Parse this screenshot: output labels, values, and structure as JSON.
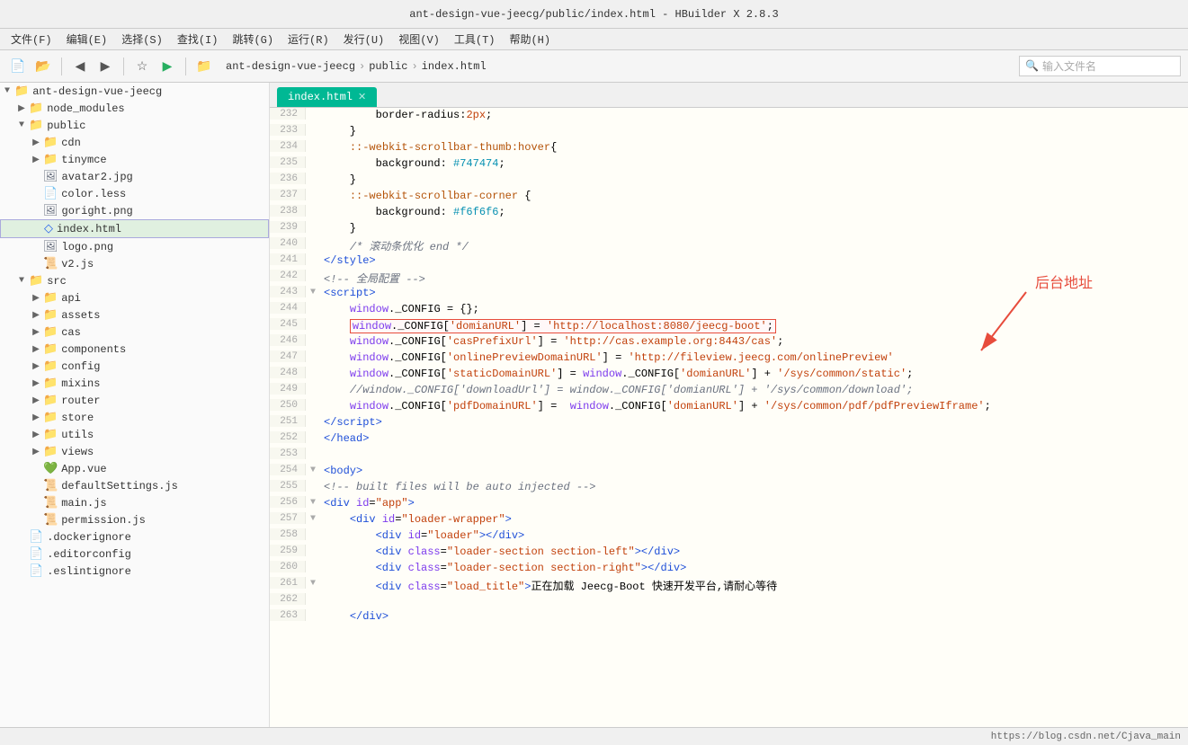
{
  "titlebar": {
    "title": "ant-design-vue-jeecg/public/index.html - HBuilder X 2.8.3"
  },
  "menubar": {
    "items": [
      "文件(F)",
      "编辑(E)",
      "选择(S)",
      "查找(I)",
      "跳转(G)",
      "运行(R)",
      "发行(U)",
      "视图(V)",
      "工具(T)",
      "帮助(H)"
    ]
  },
  "toolbar": {
    "breadcrumb": [
      "ant-design-vue-jeecg",
      "public",
      "index.html"
    ]
  },
  "search": {
    "placeholder": "输入文件名"
  },
  "tab": {
    "label": "index.html"
  },
  "sidebar": {
    "tree": [
      {
        "id": "root",
        "label": "ant-design-vue-jeecg",
        "indent": 0,
        "type": "folder",
        "expanded": true,
        "arrow": "▼"
      },
      {
        "id": "node_modules",
        "label": "node_modules",
        "indent": 1,
        "type": "folder",
        "expanded": false,
        "arrow": "▶"
      },
      {
        "id": "public",
        "label": "public",
        "indent": 1,
        "type": "folder",
        "expanded": true,
        "arrow": "▼"
      },
      {
        "id": "cdn",
        "label": "cdn",
        "indent": 2,
        "type": "folder",
        "expanded": false,
        "arrow": "▶"
      },
      {
        "id": "tinymce",
        "label": "tinymce",
        "indent": 2,
        "type": "folder",
        "expanded": false,
        "arrow": "▶"
      },
      {
        "id": "avatar2",
        "label": "avatar2.jpg",
        "indent": 2,
        "type": "image"
      },
      {
        "id": "color",
        "label": "color.less",
        "indent": 2,
        "type": "less"
      },
      {
        "id": "goright",
        "label": "goright.png",
        "indent": 2,
        "type": "image"
      },
      {
        "id": "index",
        "label": "index.html",
        "indent": 2,
        "type": "html",
        "selected": true
      },
      {
        "id": "logo",
        "label": "logo.png",
        "indent": 2,
        "type": "image"
      },
      {
        "id": "v2",
        "label": "v2.js",
        "indent": 2,
        "type": "js"
      },
      {
        "id": "src",
        "label": "src",
        "indent": 1,
        "type": "folder",
        "expanded": true,
        "arrow": "▼"
      },
      {
        "id": "api",
        "label": "api",
        "indent": 2,
        "type": "folder",
        "expanded": false,
        "arrow": "▶"
      },
      {
        "id": "assets",
        "label": "assets",
        "indent": 2,
        "type": "folder",
        "expanded": false,
        "arrow": "▶"
      },
      {
        "id": "cas",
        "label": "cas",
        "indent": 2,
        "type": "folder",
        "expanded": false,
        "arrow": "▶"
      },
      {
        "id": "components",
        "label": "components",
        "indent": 2,
        "type": "folder",
        "expanded": false,
        "arrow": "▶"
      },
      {
        "id": "config",
        "label": "config",
        "indent": 2,
        "type": "folder",
        "expanded": false,
        "arrow": "▶"
      },
      {
        "id": "mixins",
        "label": "mixins",
        "indent": 2,
        "type": "folder",
        "expanded": false,
        "arrow": "▶"
      },
      {
        "id": "router",
        "label": "router",
        "indent": 2,
        "type": "folder",
        "expanded": false,
        "arrow": "▶"
      },
      {
        "id": "store",
        "label": "store",
        "indent": 2,
        "type": "folder",
        "expanded": false,
        "arrow": "▶"
      },
      {
        "id": "utils",
        "label": "utils",
        "indent": 2,
        "type": "folder",
        "expanded": false,
        "arrow": "▶"
      },
      {
        "id": "views",
        "label": "views",
        "indent": 2,
        "type": "folder",
        "expanded": false,
        "arrow": "▶"
      },
      {
        "id": "appvue",
        "label": "App.vue",
        "indent": 2,
        "type": "vue"
      },
      {
        "id": "defaultSettings",
        "label": "defaultSettings.js",
        "indent": 2,
        "type": "js"
      },
      {
        "id": "mainjs",
        "label": "main.js",
        "indent": 2,
        "type": "js"
      },
      {
        "id": "permission",
        "label": "permission.js",
        "indent": 2,
        "type": "js"
      },
      {
        "id": "dockerignore",
        "label": ".dockerignore",
        "indent": 1,
        "type": "file"
      },
      {
        "id": "editorconfig",
        "label": ".editorconfig",
        "indent": 1,
        "type": "file"
      },
      {
        "id": "eslintignore",
        "label": ".eslintignore",
        "indent": 1,
        "type": "file"
      }
    ]
  },
  "annotation": {
    "label": "后台地址"
  },
  "code_lines": [
    {
      "num": 232,
      "fold": "",
      "content": "        border-radius:<span class='c-string'>2px</span>;"
    },
    {
      "num": 233,
      "fold": "",
      "content": "    }"
    },
    {
      "num": 234,
      "fold": "",
      "content": "    <span class='c-property'>::-webkit-scrollbar-thumb:hover</span>{"
    },
    {
      "num": 235,
      "fold": "",
      "content": "        background: <span class='c-hex'>#747474</span>;"
    },
    {
      "num": 236,
      "fold": "",
      "content": "    }"
    },
    {
      "num": 237,
      "fold": "",
      "content": "    <span class='c-property'>::-webkit-scrollbar-corner</span> {"
    },
    {
      "num": 238,
      "fold": "",
      "content": "        background: <span class='c-hex'>#f6f6f6</span>;"
    },
    {
      "num": 239,
      "fold": "",
      "content": "    }"
    },
    {
      "num": 240,
      "fold": "",
      "content": "    <span class='c-comment'>/* 滚动条优化 end */</span>"
    },
    {
      "num": 241,
      "fold": "",
      "content": "<span class='c-tag'>&lt;/style&gt;</span>"
    },
    {
      "num": 242,
      "fold": "",
      "content": "<span class='c-comment'>&lt;!-- 全局配置 --&gt;</span>"
    },
    {
      "num": 243,
      "fold": "▼",
      "content": "<span class='c-tag'>&lt;script&gt;</span>"
    },
    {
      "num": 244,
      "fold": "",
      "content": "    <span class='c-keyword'>window</span>._CONFIG = {};"
    },
    {
      "num": 245,
      "fold": "",
      "content": "    <span class='red-outline'><span class='c-keyword'>window</span>._CONFIG[<span class='c-string'>'domianURL'</span>] = <span class='c-string'>'http://localhost:8080/jeecg-boot'</span>;</span>"
    },
    {
      "num": 246,
      "fold": "",
      "content": "    <span class='c-keyword'>window</span>._CONFIG[<span class='c-string'>'casPrefixUrl'</span>] = <span class='c-string'>'http://cas.example.org:8443/cas'</span>;"
    },
    {
      "num": 247,
      "fold": "",
      "content": "    <span class='c-keyword'>window</span>._CONFIG[<span class='c-string'>'onlinePreviewDomainURL'</span>] = <span class='c-string'>'http://fileview.jeecg.com/onlinePreview'</span>"
    },
    {
      "num": 248,
      "fold": "",
      "content": "    <span class='c-keyword'>window</span>._CONFIG[<span class='c-string'>'staticDomainURL'</span>] = <span class='c-keyword'>window</span>._CONFIG[<span class='c-string'>'domianURL'</span>] + <span class='c-string'>'/sys/common/static'</span>;"
    },
    {
      "num": 249,
      "fold": "",
      "content": "    <span class='c-comment'>//window._CONFIG['downloadUrl'] = window._CONFIG['domianURL'] + '/sys/common/download';</span>"
    },
    {
      "num": 250,
      "fold": "",
      "content": "    <span class='c-keyword'>window</span>._CONFIG[<span class='c-string'>'pdfDomainURL'</span>] =  <span class='c-keyword'>window</span>._CONFIG[<span class='c-string'>'domianURL'</span>] + <span class='c-string'>'/sys/common/pdf/pdfPreviewIframe'</span>;"
    },
    {
      "num": 251,
      "fold": "",
      "content": "<span class='c-tag'>&lt;/script&gt;</span>"
    },
    {
      "num": 252,
      "fold": "",
      "content": "<span class='c-tag'>&lt;/head&gt;</span>"
    },
    {
      "num": 253,
      "fold": "",
      "content": ""
    },
    {
      "num": 254,
      "fold": "▼",
      "content": "<span class='c-tag'>&lt;body&gt;</span>"
    },
    {
      "num": 255,
      "fold": "",
      "content": "<span class='c-comment'>&lt;!-- built files will be auto injected --&gt;</span>"
    },
    {
      "num": 256,
      "fold": "▼",
      "content": "<span class='c-tag'>&lt;div</span> <span class='c-attr'>id</span>=<span class='c-value'>\"app\"</span><span class='c-tag'>&gt;</span>"
    },
    {
      "num": 257,
      "fold": "▼",
      "content": "    <span class='c-tag'>&lt;div</span> <span class='c-attr'>id</span>=<span class='c-value'>\"loader-wrapper\"</span><span class='c-tag'>&gt;</span>"
    },
    {
      "num": 258,
      "fold": "",
      "content": "        <span class='c-tag'>&lt;div</span> <span class='c-attr'>id</span>=<span class='c-value'>\"loader\"</span><span class='c-tag'>&gt;&lt;/div&gt;</span>"
    },
    {
      "num": 259,
      "fold": "",
      "content": "        <span class='c-tag'>&lt;div</span> <span class='c-attr'>class</span>=<span class='c-value'>\"loader-section section-left\"</span><span class='c-tag'>&gt;&lt;/div&gt;</span>"
    },
    {
      "num": 260,
      "fold": "",
      "content": "        <span class='c-tag'>&lt;div</span> <span class='c-attr'>class</span>=<span class='c-value'>\"loader-section section-right\"</span><span class='c-tag'>&gt;&lt;/div&gt;</span>"
    },
    {
      "num": 261,
      "fold": "▼",
      "content": "        <span class='c-tag'>&lt;div</span> <span class='c-attr'>class</span>=<span class='c-value'>\"load_title\"</span><span class='c-tag'>&gt;</span>正在加载 Jeecg-Boot 快速开发平台,请耐心等待"
    },
    {
      "num": 262,
      "fold": "",
      "content": ""
    },
    {
      "num": 263,
      "fold": "",
      "content": "    <span class='c-tag'>&lt;/div&gt;</span>"
    }
  ],
  "statusbar": {
    "text": "https://blog.csdn.net/Cjava_main"
  }
}
